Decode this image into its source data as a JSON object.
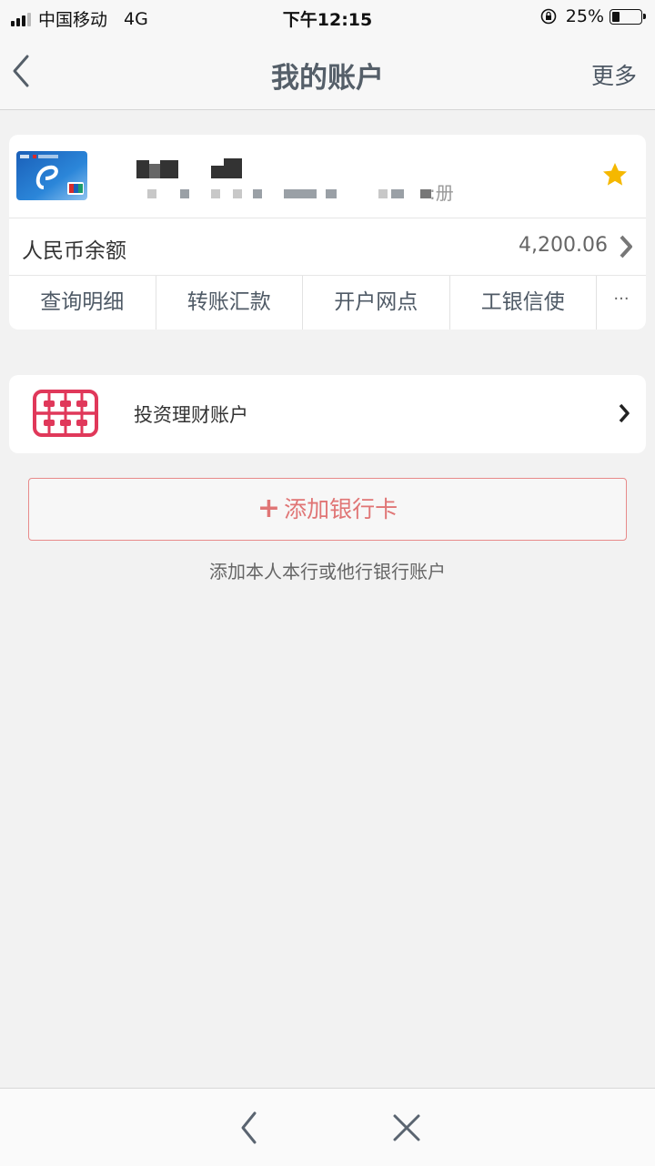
{
  "status_bar": {
    "carrier": "中国移动",
    "network": "4G",
    "time": "下午12:15",
    "battery_percent": "25%",
    "battery_level": 0.25
  },
  "nav": {
    "title": "我的账户",
    "more_label": "更多",
    "back_icon": "chevron-left-icon"
  },
  "account_card": {
    "card_status_suffix": ":册",
    "favorite_icon": "star-icon",
    "favorite_color": "#f5b800",
    "balance_label": "人民币余额",
    "balance_value": "4,200.06",
    "actions": [
      "查询明细",
      "转账汇款",
      "开户网点",
      "工银信使"
    ],
    "more_actions": "···"
  },
  "invest": {
    "label": "投资理财账户",
    "icon": "abacus-icon",
    "icon_color": "#e0385a"
  },
  "add_card": {
    "plus": "+",
    "label": "添加银行卡",
    "hint": "添加本人本行或他行银行账户",
    "accent": "#e07575"
  },
  "bottom_bar": {
    "back_icon": "chevron-left-icon",
    "close_icon": "close-icon"
  }
}
